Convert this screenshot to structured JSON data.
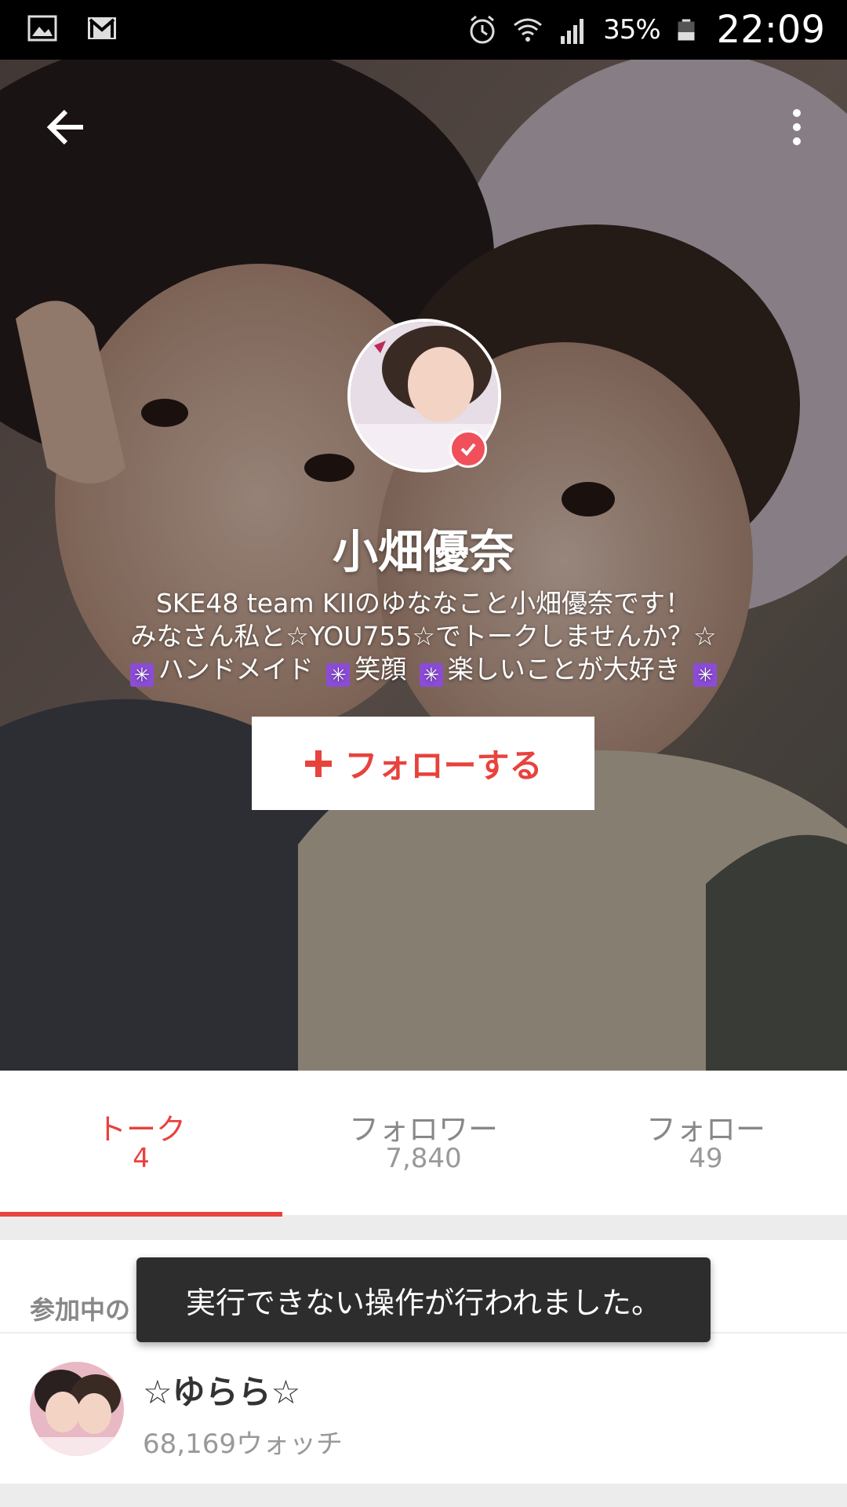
{
  "status_bar": {
    "battery_percent": "35%",
    "time": "22:09",
    "icons": [
      "image-icon",
      "gmail-icon",
      "alarm-icon",
      "wifi-icon",
      "signal-icon",
      "battery-icon"
    ]
  },
  "header": {
    "back_icon": "arrow-left-icon",
    "menu_icon": "more-vert-icon"
  },
  "profile": {
    "name": "小畑優奈",
    "bio_lines": [
      "SKE48 team KIIのゆななこと小畑優奈です！",
      "みなさん私と☆YOU755☆でトークしませんか？☆"
    ],
    "bio_line3_parts": [
      "ハンドメイド",
      "笑顔",
      "楽しいことが大好き"
    ],
    "bio_symbol": "✳",
    "follow_label": "フォローする",
    "follow_icon": "plus-icon",
    "verified": true
  },
  "tabs": [
    {
      "label": "トーク",
      "count": "4",
      "active": true
    },
    {
      "label": "フォロワー",
      "count": "7,840",
      "active": false
    },
    {
      "label": "フォロー",
      "count": "49",
      "active": false
    }
  ],
  "section": {
    "header": "参加中の",
    "items": [
      {
        "title": "☆ゆらら☆",
        "subtitle": "68,169ウォッチ"
      }
    ]
  },
  "toast": {
    "message": "実行できない操作が行われました。"
  },
  "colors": {
    "accent": "#e8423d",
    "bio_symbol_bg": "#8b4cd6",
    "toast_bg": "#2d2d2d"
  }
}
